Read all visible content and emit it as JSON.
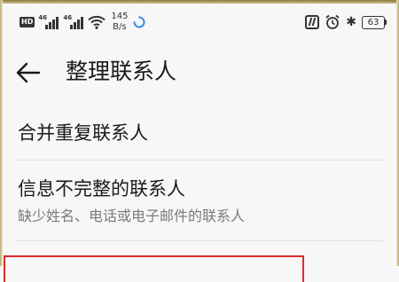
{
  "status_bar": {
    "hd_label": "HD",
    "signal1_label": "46",
    "signal2_label": "46",
    "net_speed_value": "145",
    "net_speed_unit": "B/s",
    "battery_level": "63",
    "icons": [
      "hd-icon",
      "signal-icon",
      "signal-icon",
      "wifi-icon",
      "loading-icon",
      "nfc-icon",
      "alarm-icon",
      "bluetooth-icon",
      "battery-icon"
    ]
  },
  "toolbar": {
    "back_icon": "back-arrow-icon",
    "title": "整理联系人"
  },
  "list": {
    "items": [
      {
        "title": "合并重复联系人",
        "subtitle": ""
      },
      {
        "title": "信息不完整的联系人",
        "subtitle": "缺少姓名、电话或电子邮件的联系人"
      }
    ]
  },
  "colors": {
    "background": "#f7f7f7",
    "text_primary": "#1a1a1a",
    "text_secondary": "#7a7a7a",
    "highlight": "#e02a2a"
  }
}
